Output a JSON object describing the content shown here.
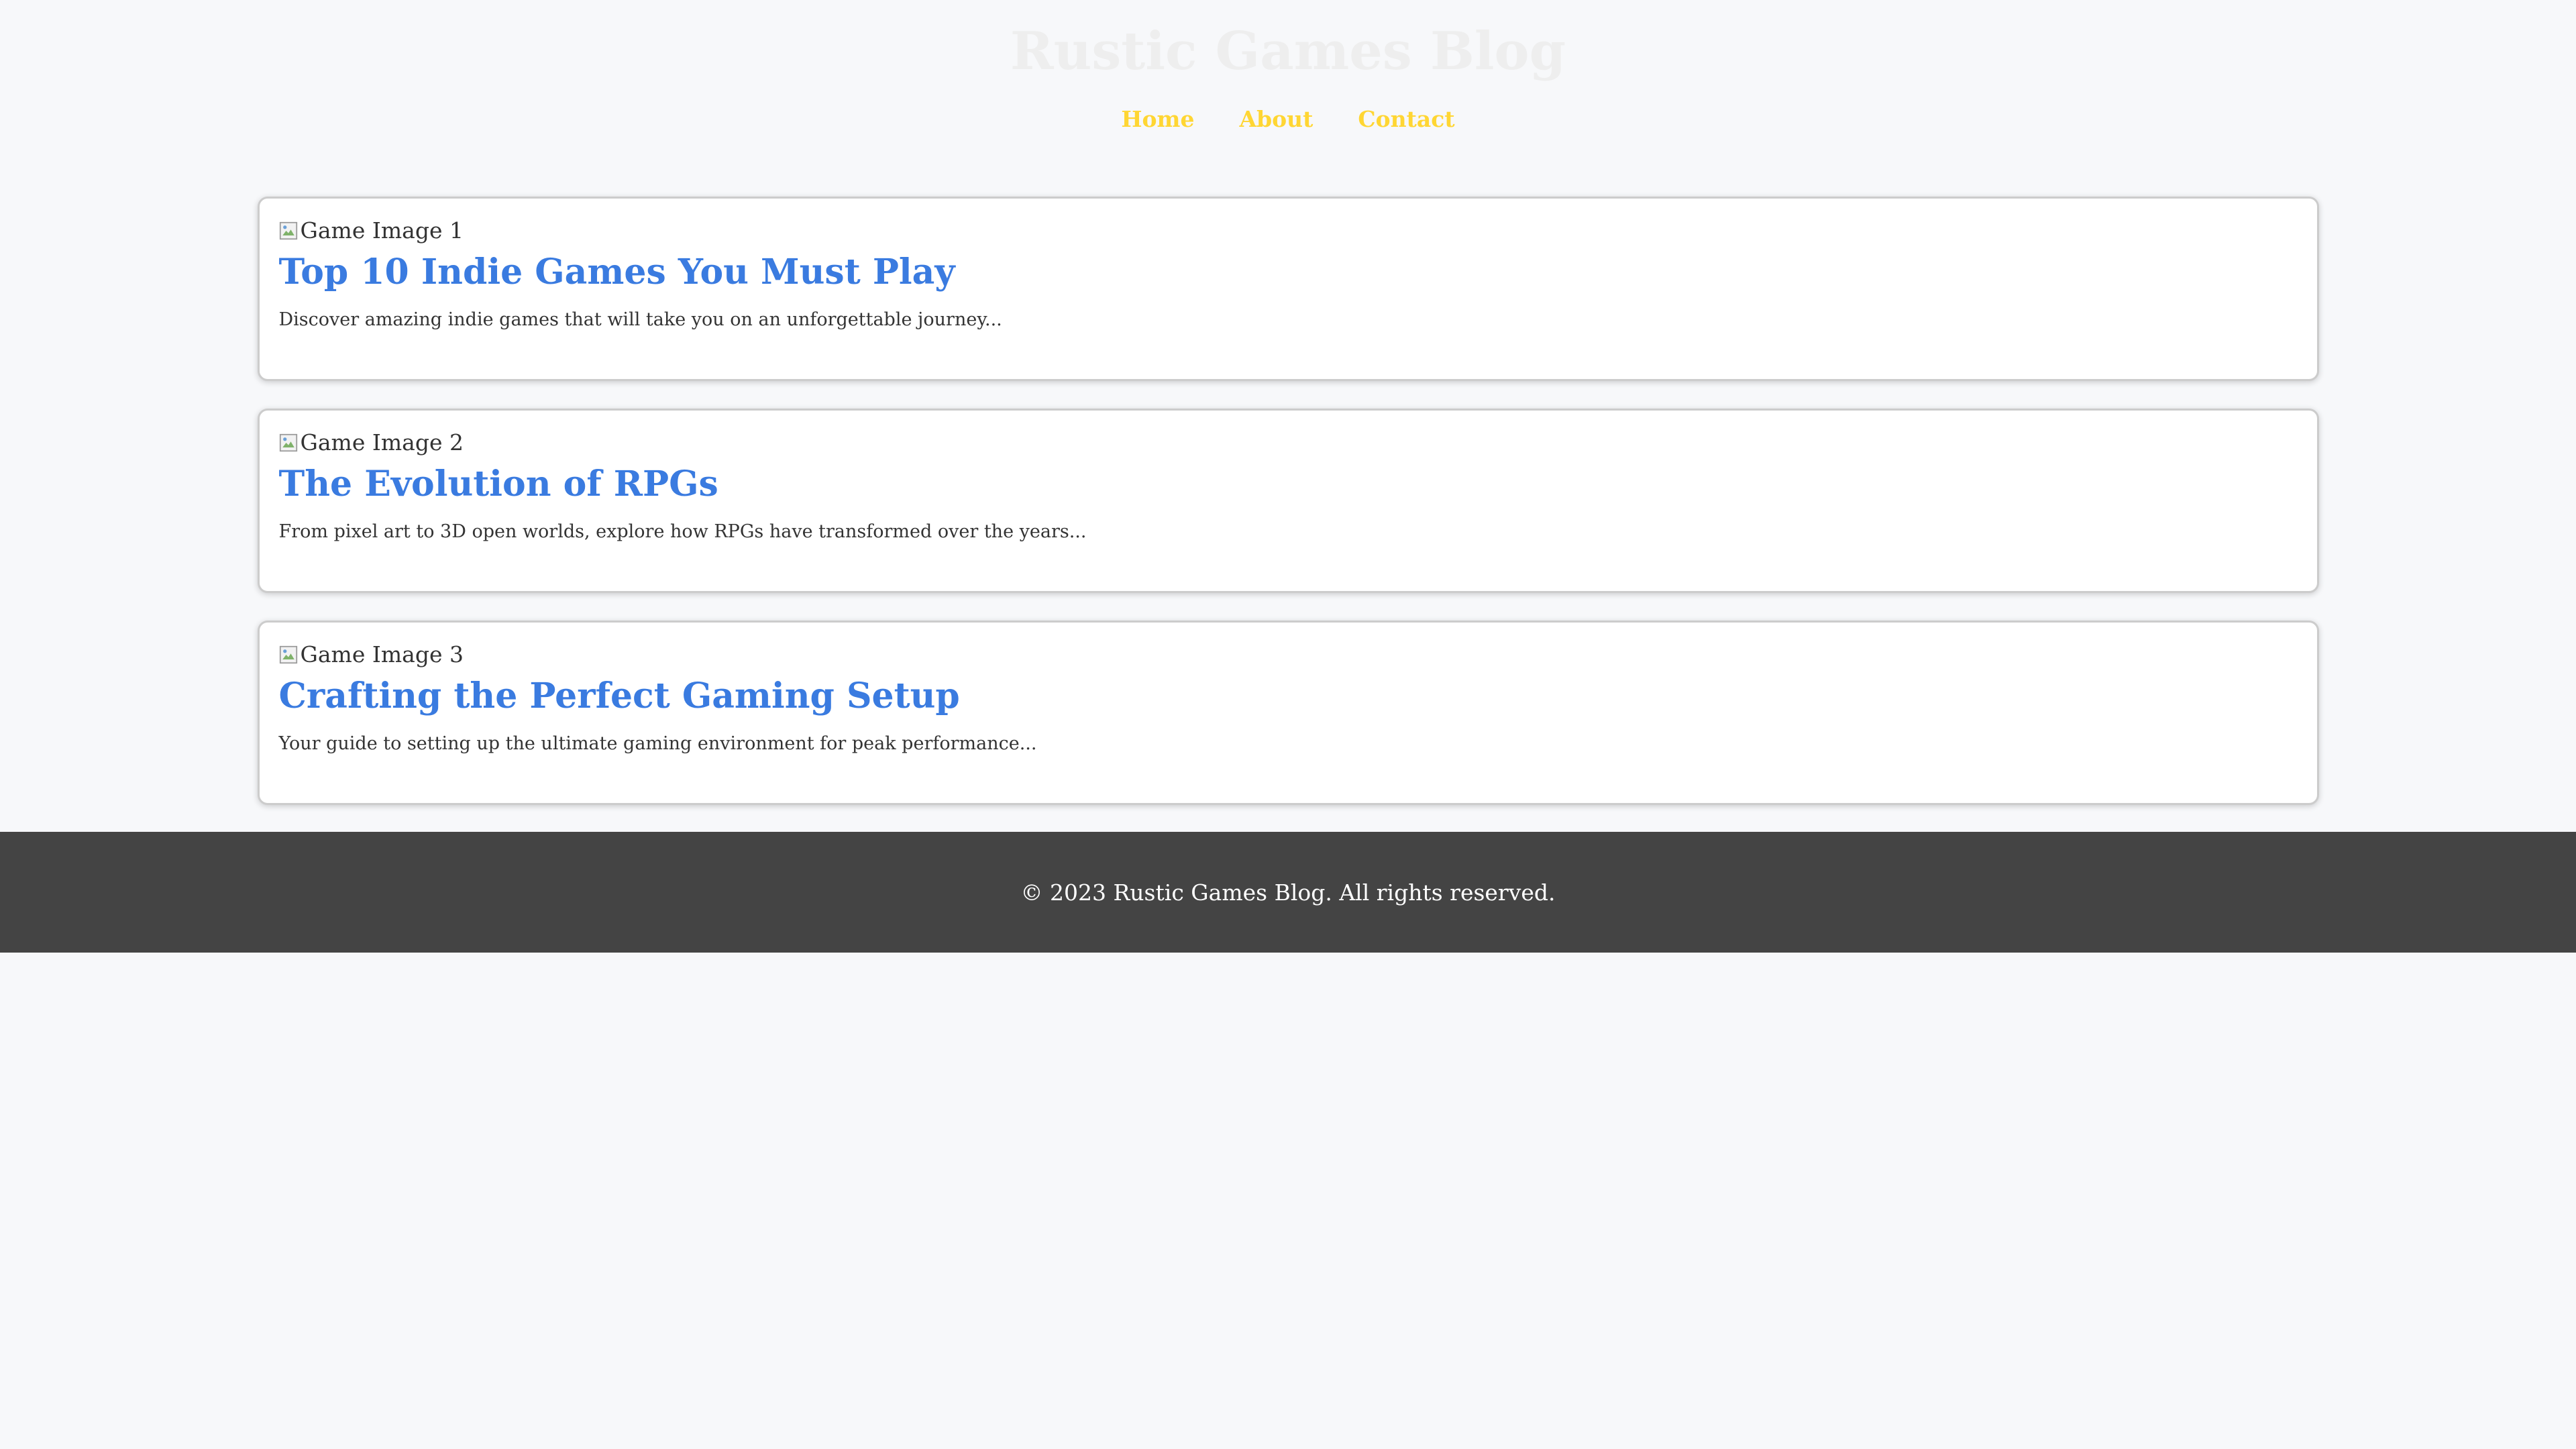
{
  "header": {
    "title": "Rustic Games Blog",
    "nav": [
      {
        "label": "Home"
      },
      {
        "label": "About"
      },
      {
        "label": "Contact"
      }
    ]
  },
  "posts": [
    {
      "image_alt": "Game Image 1",
      "title": "Top 10 Indie Games You Must Play",
      "excerpt": "Discover amazing indie games that will take you on an unforgettable journey..."
    },
    {
      "image_alt": "Game Image 2",
      "title": "The Evolution of RPGs",
      "excerpt": "From pixel art to 3D open worlds, explore how RPGs have transformed over the years..."
    },
    {
      "image_alt": "Game Image 3",
      "title": "Crafting the Perfect Gaming Setup",
      "excerpt": "Your guide to setting up the ultimate gaming environment for peak performance..."
    }
  ],
  "footer": {
    "text": "© 2023 Rustic Games Blog. All rights reserved."
  },
  "colors": {
    "title": "#eeeeee",
    "nav": "#ffd633",
    "post_title": "#3a7be0",
    "footer_bg": "#444444",
    "page_bg": "#f7f8fa"
  },
  "icons": {
    "image_placeholder": "broken-image-icon"
  }
}
